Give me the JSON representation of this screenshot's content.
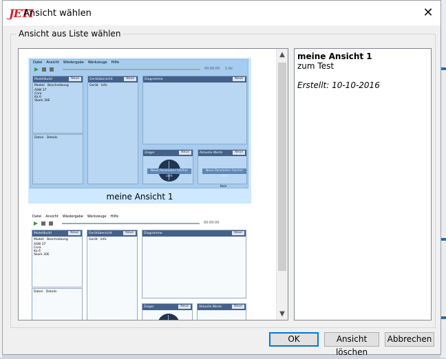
{
  "dialog": {
    "logo": "JETI",
    "title": "Ansicht wählen",
    "close_glyph": "✕"
  },
  "group": {
    "label": "Ansicht aus Liste wählen"
  },
  "views": [
    {
      "name": "meine Ansicht 1",
      "selected": true
    },
    {
      "name": "",
      "selected": false
    }
  ],
  "preview": {
    "menu": [
      "Datei",
      "Ansicht",
      "Wiedergabe",
      "Werkzeuge",
      "Hilfe"
    ],
    "time": "00:00:00",
    "speed": "1.0x",
    "model_panel": {
      "title": "Modellbuild",
      "btn": "Neue",
      "cols": [
        "Modell",
        "Beschreibung"
      ],
      "rows": [
        "ASW 27",
        "Cora",
        "Ka 6",
        "Skark 30E"
      ]
    },
    "device_panel": {
      "title": "Gerätübersicht",
      "btn": "Neue",
      "cols": [
        "Gerät",
        "Info"
      ]
    },
    "diagram_panel": {
      "title": "Diagramme",
      "btn": "Neue"
    },
    "data_panel": {
      "cols": [
        "Daten",
        "Details"
      ]
    },
    "pointer_panel": {
      "title": "Zeiger",
      "btn": "Neue",
      "hint": "Neue Parameter hierher zieh"
    },
    "values_panel": {
      "title": "Aktuelle Werte",
      "btn": "Neue",
      "hint": "Neue Parameter hierher zieh"
    },
    "footer": "Kein"
  },
  "details": {
    "name": "meine Ansicht 1",
    "description": "zum Test",
    "created": "Erstellt: 10-10-2016"
  },
  "buttons": {
    "ok": "OK",
    "delete": "Ansicht löschen",
    "cancel": "Abbrechen"
  },
  "scrollbar": {
    "up": "▲",
    "down": "▼"
  }
}
